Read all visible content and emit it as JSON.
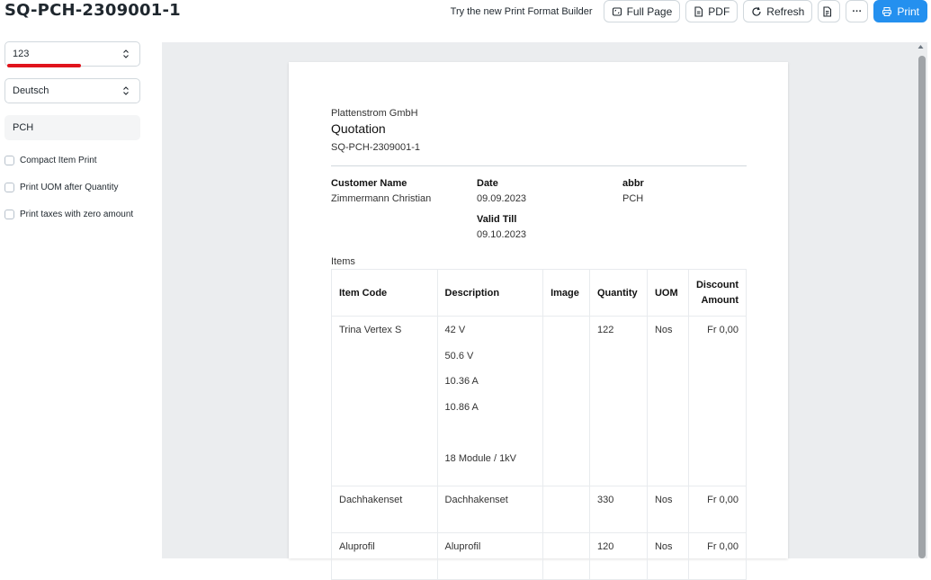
{
  "header": {
    "title": "SQ-PCH-2309001-1",
    "builder_link": "Try the new Print Format Builder",
    "full_page_label": "Full Page",
    "pdf_label": "PDF",
    "refresh_label": "Refresh",
    "more_label": "···",
    "print_label": "Print",
    "primary_color": "#2490ef"
  },
  "sidebar": {
    "print_format": "123",
    "language": "Deutsch",
    "letterhead": "PCH",
    "checkboxes": [
      {
        "label": "Compact Item Print",
        "checked": false
      },
      {
        "label": "Print UOM after Quantity",
        "checked": false
      },
      {
        "label": "Print taxes with zero amount",
        "checked": false
      }
    ],
    "annotation_color": "#e0141c"
  },
  "document": {
    "company": "Plattenstrom GmbH",
    "doctype": "Quotation",
    "name": "SQ-PCH-2309001-1",
    "customer_name_label": "Customer Name",
    "customer_name": "Zimmermann Christian",
    "date_label": "Date",
    "date": "09.09.2023",
    "valid_till_label": "Valid Till",
    "valid_till": "09.10.2023",
    "abbr_label": "abbr",
    "abbr": "PCH",
    "items_label": "Items",
    "columns": {
      "item_code": "Item Code",
      "description": "Description",
      "image": "Image",
      "quantity": "Quantity",
      "uom": "UOM",
      "discount_line1": "Discount",
      "discount_line2": "Amount"
    },
    "rows": [
      {
        "item_code": "Trina Vertex S",
        "description": [
          "42 V",
          "50.6 V",
          "10.36 A",
          "10.86 A",
          "",
          "18 Module / 1kV"
        ],
        "quantity": "122",
        "uom": "Nos",
        "discount": "Fr 0,00"
      },
      {
        "item_code": "Dachhakenset",
        "description": [
          "Dachhakenset"
        ],
        "quantity": "330",
        "uom": "Nos",
        "discount": "Fr 0,00"
      },
      {
        "item_code": "Aluprofil",
        "description": [
          "Aluprofil"
        ],
        "quantity": "120",
        "uom": "Nos",
        "discount": "Fr 0,00"
      }
    ]
  }
}
